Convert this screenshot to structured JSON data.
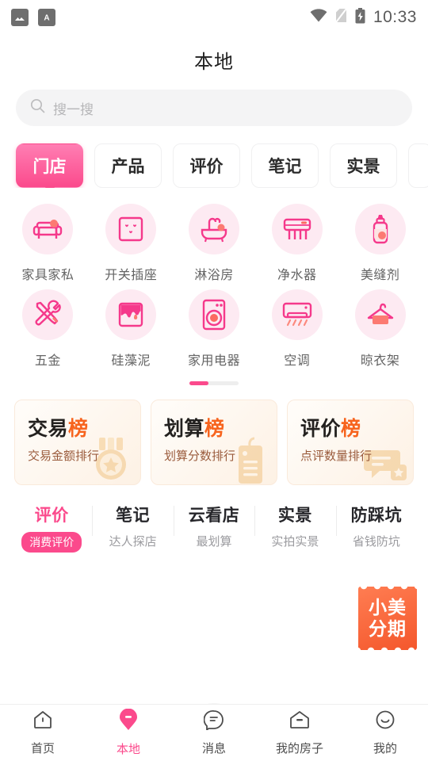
{
  "statusbar": {
    "time": "10:33",
    "left_icons": [
      "image-icon",
      "app-a-icon"
    ],
    "right_icons": [
      "wifi-icon",
      "sim-slash-icon",
      "battery-charging-icon"
    ]
  },
  "header": {
    "title": "本地"
  },
  "search": {
    "placeholder": "搜一搜",
    "icon": "search-icon"
  },
  "tabs": [
    {
      "label": "门店",
      "active": true
    },
    {
      "label": "产品",
      "active": false
    },
    {
      "label": "评价",
      "active": false
    },
    {
      "label": "笔记",
      "active": false
    },
    {
      "label": "实景",
      "active": false
    },
    {
      "label": "",
      "active": false
    }
  ],
  "categories": [
    {
      "label": "家具家私",
      "icon": "sofa-icon"
    },
    {
      "label": "开关插座",
      "icon": "power-outlet-icon"
    },
    {
      "label": "淋浴房",
      "icon": "bathtub-shower-icon"
    },
    {
      "label": "净水器",
      "icon": "water-purifier-icon"
    },
    {
      "label": "美缝剂",
      "icon": "sealant-tube-icon"
    },
    {
      "label": "五金",
      "icon": "tools-icon"
    },
    {
      "label": "硅藻泥",
      "icon": "paint-wall-icon"
    },
    {
      "label": "家用电器",
      "icon": "washing-machine-icon"
    },
    {
      "label": "空调",
      "icon": "air-conditioner-icon"
    },
    {
      "label": "晾衣架",
      "icon": "clothes-hanger-icon"
    }
  ],
  "pager": {
    "pages": 3,
    "current": 1
  },
  "rank_cards": [
    {
      "title_main": "交易",
      "title_accent": "榜",
      "subtitle": "交易金额排行",
      "art": "medal-icon"
    },
    {
      "title_main": "划算",
      "title_accent": "榜",
      "subtitle": "划算分数排行",
      "art": "price-tag-icon"
    },
    {
      "title_main": "评价",
      "title_accent": "榜",
      "subtitle": "点评数量排行",
      "art": "comment-star-icon"
    }
  ],
  "filters": [
    {
      "title": "评价",
      "sub": "消费评价",
      "active": true
    },
    {
      "title": "笔记",
      "sub": "达人探店",
      "active": false
    },
    {
      "title": "云看店",
      "sub": "最划算",
      "active": false
    },
    {
      "title": "实景",
      "sub": "实拍实景",
      "active": false
    },
    {
      "title": "防踩坑",
      "sub": "省钱防坑",
      "active": false
    }
  ],
  "float_ticket": {
    "line1": "小美",
    "line2": "分期"
  },
  "bottom_nav": [
    {
      "label": "首页",
      "icon": "home-icon",
      "active": false
    },
    {
      "label": "本地",
      "icon": "map-pin-icon",
      "active": true
    },
    {
      "label": "消息",
      "icon": "message-icon",
      "active": false
    },
    {
      "label": "我的房子",
      "icon": "house-icon",
      "active": false
    },
    {
      "label": "我的",
      "icon": "smiley-icon",
      "active": false
    }
  ],
  "colors": {
    "accent_pink": "#fb4a8c",
    "accent_pink_light": "#ff7eb3",
    "accent_orange": "#f7641e",
    "ticket_orange": "#f4572c",
    "cat_bg": "#fdeaf2",
    "text_dark": "#23211f",
    "text_grey": "#9b9b9f"
  }
}
